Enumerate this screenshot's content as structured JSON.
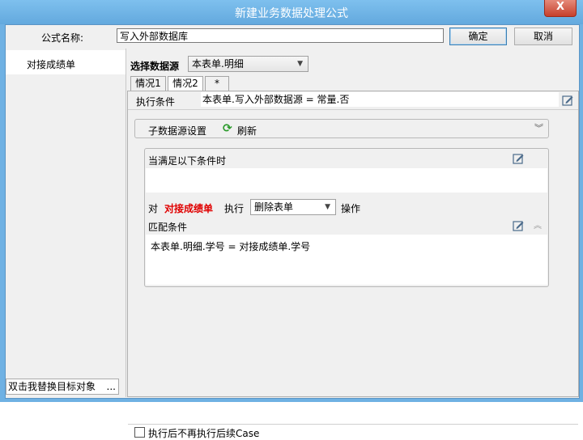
{
  "window": {
    "title": "新建业务数据处理公式",
    "close_label": "X"
  },
  "top": {
    "name_label": "公式名称:",
    "name_value": "写入外部数据库",
    "ok_label": "确定",
    "cancel_label": "取消"
  },
  "sidebar": {
    "items": [
      {
        "label": "对接成绩单"
      }
    ],
    "bottom_value": "双击我替换目标对象",
    "bottom_button": "..."
  },
  "source": {
    "label": "选择数据源",
    "selected": "本表单.明细"
  },
  "tabs": [
    {
      "label": "情况1"
    },
    {
      "label": "情况2"
    },
    {
      "label": "*"
    }
  ],
  "condition": {
    "label": "执行条件",
    "value": "本表单.写入外部数据源 = 常量.否"
  },
  "subsource": {
    "title": "子数据源设置",
    "refresh_label": "刷新"
  },
  "rule": {
    "when_label": "当满足以下条件时",
    "prefix": "对",
    "target": "对接成绩单",
    "exec_label": "执行",
    "action_selected": "删除表单",
    "op_label": "操作",
    "match_label": "匹配条件",
    "match_value": "本表单.明细.学号 = 对接成绩单.学号"
  },
  "footer": {
    "checkbox_label": "执行后不再执行后续Case"
  },
  "colors": {
    "title_bar": "#6fb1e3",
    "target_text": "#e00000",
    "refresh_icon": "#2a9a2a"
  }
}
